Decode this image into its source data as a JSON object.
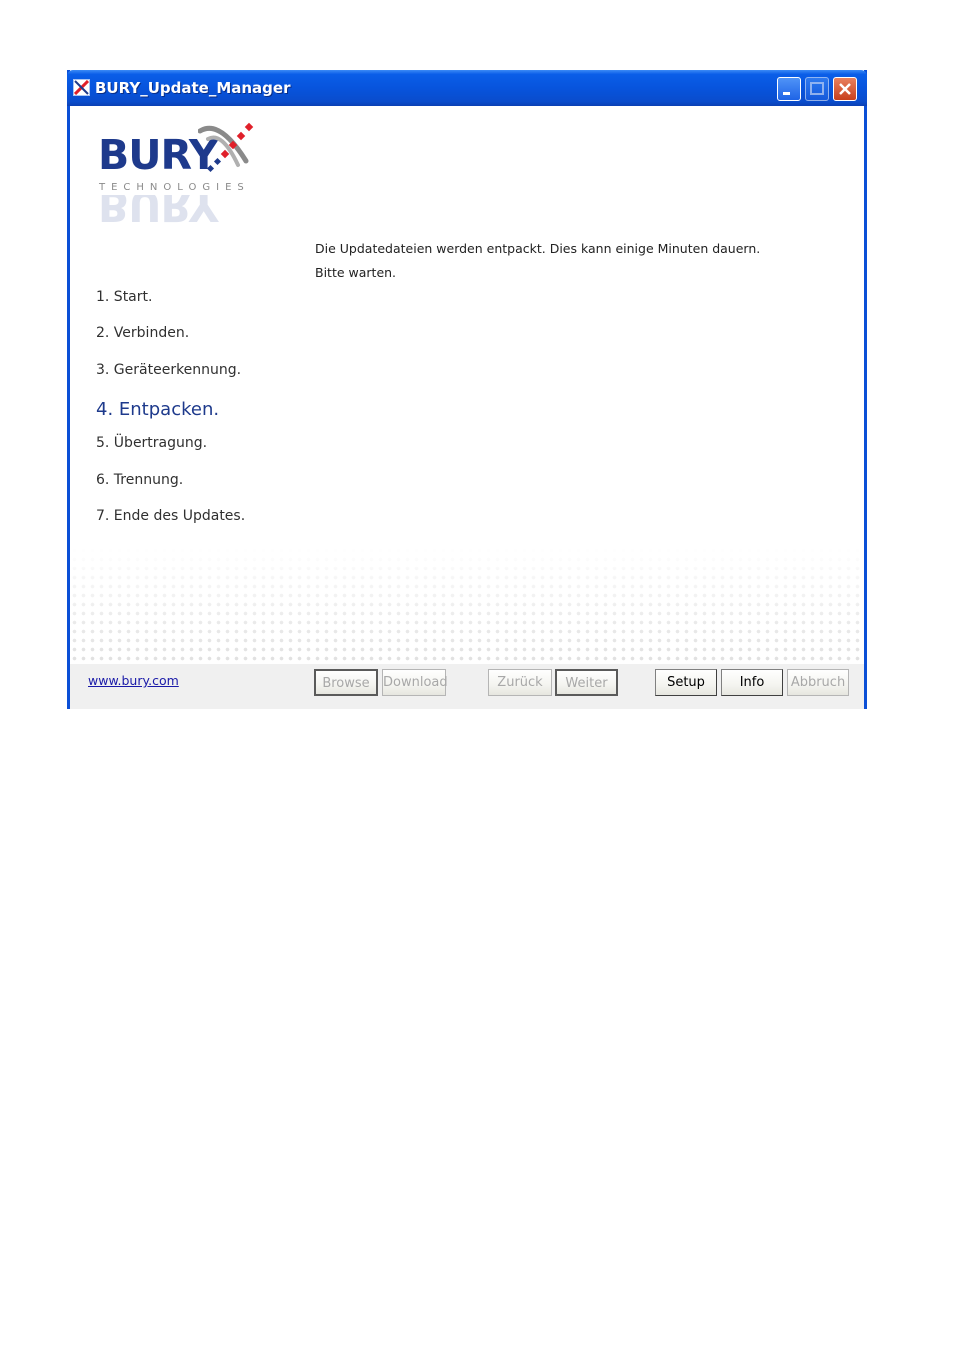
{
  "window": {
    "title": "BURY_Update_Manager"
  },
  "logo": {
    "brand": "BURY",
    "tagline": "TECHNOLOGIES"
  },
  "steps": [
    {
      "label": "1. Start."
    },
    {
      "label": "2. Verbinden."
    },
    {
      "label": "3. Geräteerkennung."
    },
    {
      "label": "4. Entpacken.",
      "active": true
    },
    {
      "label": "5. Übertragung."
    },
    {
      "label": "6. Trennung."
    },
    {
      "label": "7. Ende des Updates."
    }
  ],
  "message": {
    "line1": "Die Updatedateien werden entpackt. Dies kann einige Minuten dauern.",
    "line2": "Bitte warten."
  },
  "footer": {
    "link": "www.bury.com",
    "buttons": {
      "browse": "Browse",
      "download": "Download",
      "zurueck": "Zurück",
      "weiter": "Weiter",
      "setup": "Setup",
      "info": "Info",
      "abbruch": "Abbruch"
    }
  },
  "colors": {
    "titlebar": "#0754dd",
    "brand_blue": "#1e3a8c",
    "brand_red": "#e0202a",
    "link": "#1a1aa8"
  }
}
